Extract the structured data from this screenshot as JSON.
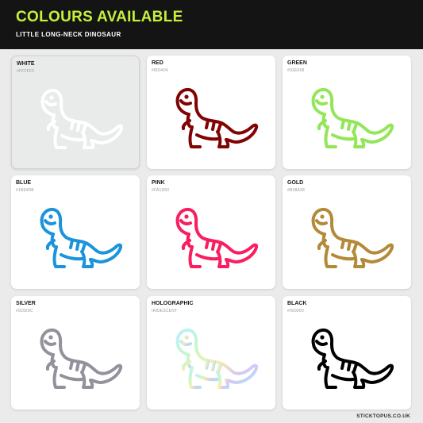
{
  "header": {
    "title": "COLOURS AVAILABLE",
    "subtitle": "LITTLE LONG-NECK DINOSAUR"
  },
  "swatches": [
    {
      "name": "WHITE",
      "code": "#FFFFFF",
      "color": "#FFFFFF"
    },
    {
      "name": "RED",
      "code": "#800404",
      "color": "#800404"
    },
    {
      "name": "GREEN",
      "code": "#93E658",
      "color": "#93E658"
    },
    {
      "name": "BLUE",
      "code": "#1B94DB",
      "color": "#1B94DB"
    },
    {
      "name": "PINK",
      "code": "#FA1D60",
      "color": "#FA1D60"
    },
    {
      "name": "GOLD",
      "code": "#B38A38",
      "color": "#B38A38"
    },
    {
      "name": "SILVER",
      "code": "#92929C",
      "color": "#92929C"
    },
    {
      "name": "HOLOGRAPHIC",
      "code": "IRIDESCENT",
      "color": "holographic"
    },
    {
      "name": "BLACK",
      "code": "#000000",
      "color": "#000000"
    }
  ],
  "icon": "long-neck-dinosaur-icon",
  "colors": {
    "header_bg": "#141414",
    "title_accent": "#C6F03A",
    "page_bg": "#EBEBEB",
    "card_bg": "#FFFFFF",
    "white_card_bg": "#E9EBEA"
  },
  "footer": {
    "brand": "STICKTOPUS.CO.UK"
  }
}
